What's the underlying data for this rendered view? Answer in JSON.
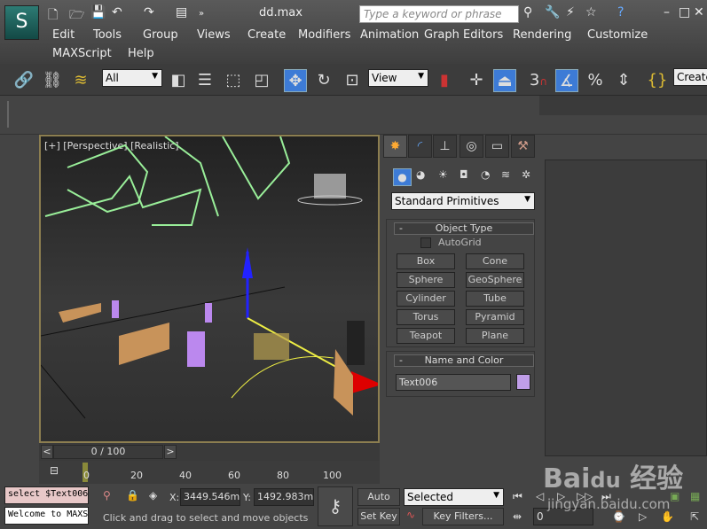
{
  "app": {
    "title": "dd.max",
    "logo": "3ds-max-logo"
  },
  "search": {
    "placeholder": "Type a keyword or phrase"
  },
  "menu": [
    "Edit",
    "Tools",
    "Group",
    "Views",
    "Create",
    "Modifiers",
    "Animation",
    "Graph Editors",
    "Rendering",
    "Customize",
    "MAXScript",
    "Help"
  ],
  "toolbar": {
    "selection_filter": "All",
    "ref_coord": "View",
    "snap_value": "3",
    "named_sel": "Create"
  },
  "viewport": {
    "label": "[+] [Perspective] [Realistic]"
  },
  "command_panel": {
    "category": "Standard Primitives",
    "object_type": {
      "title": "Object Type",
      "collapse": "-",
      "autogrid": "AutoGrid",
      "autogrid_checked": false,
      "buttons": [
        "Box",
        "Cone",
        "Sphere",
        "GeoSphere",
        "Cylinder",
        "Tube",
        "Torus",
        "Pyramid",
        "Teapot",
        "Plane"
      ]
    },
    "name_color": {
      "title": "Name and Color",
      "collapse": "-",
      "name": "Text006",
      "color": "#c09ee8"
    }
  },
  "timeline": {
    "frame": "0 / 100",
    "prev": "<",
    "next": ">",
    "ticks": [
      "0",
      "20",
      "40",
      "60",
      "80",
      "100"
    ]
  },
  "status": {
    "maxscript_input": "select $Text006",
    "maxscript_output": "Welcome to MAXScript",
    "x_label": "X:",
    "x": "3449.546m",
    "y_label": "Y:",
    "y": "1492.983m",
    "prompt": "Click and drag to select and move objects",
    "auto_key": "Auto Key",
    "set_key": "Set Key",
    "key_mode": "Selected",
    "key_filters": "Key Filters...",
    "current_frame": "0"
  },
  "watermark": {
    "text": "Bai du 经验",
    "url": "jingyan.baidu.com"
  }
}
